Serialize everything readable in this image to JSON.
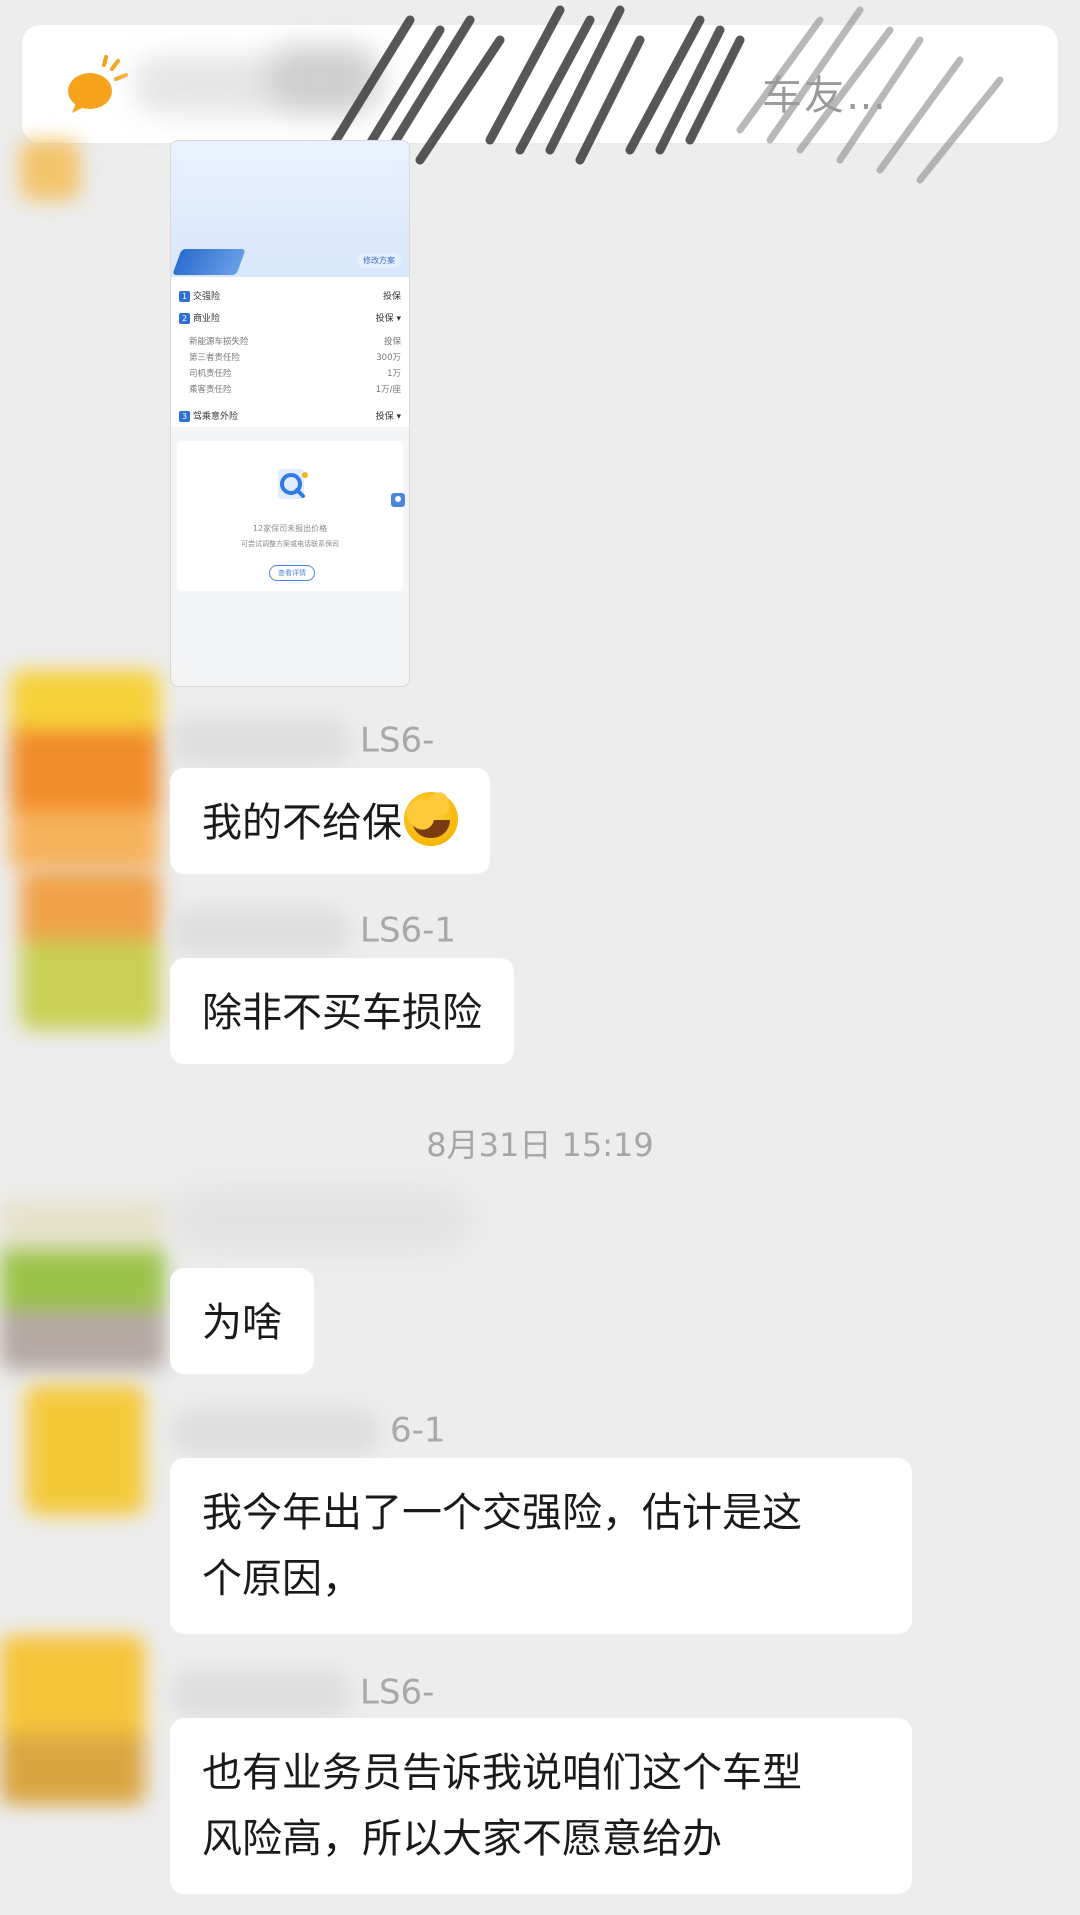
{
  "notice_bar": {
    "title_partial": "车友…",
    "icon": "chat-bubble-sun-icon"
  },
  "shared_image": {
    "tag": "修改方案",
    "rows": [
      {
        "num": "1",
        "label": "交强险",
        "value": "投保"
      },
      {
        "num": "2",
        "label": "商业险",
        "value": "投保 ▾"
      }
    ],
    "sub_rows": [
      {
        "label": "新能源车损失险",
        "value": "投保"
      },
      {
        "label": "第三者责任险",
        "value": "300万"
      },
      {
        "label": "司机责任险",
        "value": "1万"
      },
      {
        "label": "乘客责任险",
        "value": "1万/座"
      }
    ],
    "row3": {
      "num": "3",
      "label": "驾乘意外险",
      "value": "投保 ▾"
    },
    "panel_line1": "12家保司未报出价格",
    "panel_line2": "可尝试调整方案或电话联系保司",
    "panel_button": "查看详情"
  },
  "messages": [
    {
      "sender_suffix": "LS6-",
      "text": "我的不给保",
      "emoji": "face-tears-emoji"
    },
    {
      "sender_suffix": "LS6-1",
      "text": "除非不买车损险"
    },
    {
      "text": "为啥"
    },
    {
      "sender_suffix": "6-1",
      "text_lines": [
        "我今年出了一个交强险，估计是这",
        "个原因，"
      ]
    },
    {
      "sender_suffix": "LS6-",
      "text_lines": [
        "也有业务员告诉我说咱们这个车型",
        "风险高，所以大家不愿意给办"
      ]
    }
  ],
  "timestamp": "8月31日 15:19"
}
